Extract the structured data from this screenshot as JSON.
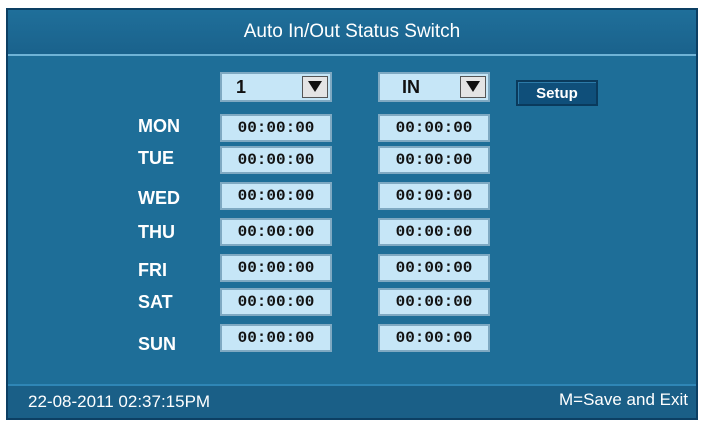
{
  "window": {
    "title": "Auto In/Out Status Switch"
  },
  "controls": {
    "schedule_select": {
      "value": "1"
    },
    "status_select": {
      "value": "IN"
    },
    "setup_label": "Setup"
  },
  "schedule": [
    {
      "day": "MON",
      "time1": "00:00:00",
      "time2": "00:00:00"
    },
    {
      "day": "TUE",
      "time1": "00:00:00",
      "time2": "00:00:00"
    },
    {
      "day": "WED",
      "time1": "00:00:00",
      "time2": "00:00:00"
    },
    {
      "day": "THU",
      "time1": "00:00:00",
      "time2": "00:00:00"
    },
    {
      "day": "FRI",
      "time1": "00:00:00",
      "time2": "00:00:00"
    },
    {
      "day": "SAT",
      "time1": "00:00:00",
      "time2": "00:00:00"
    },
    {
      "day": "SUN",
      "time1": "00:00:00",
      "time2": "00:00:00"
    }
  ],
  "footer": {
    "datetime": "22-08-2011 02:37:15PM",
    "hint": "M=Save and Exit"
  },
  "icons": {
    "dropdown": "dropdown-arrow-icon"
  },
  "colors": {
    "background": "#1e6e98",
    "field": "#c6e6f7",
    "text": "#ffffff"
  }
}
